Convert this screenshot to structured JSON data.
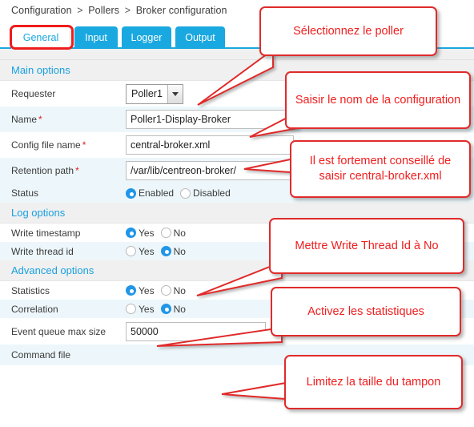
{
  "breadcrumb": {
    "items": [
      "Configuration",
      "Pollers",
      "Broker configuration"
    ],
    "separator": ">"
  },
  "tabs": [
    {
      "label": "General",
      "active": true
    },
    {
      "label": "Input",
      "active": false
    },
    {
      "label": "Logger",
      "active": false
    },
    {
      "label": "Output",
      "active": false
    }
  ],
  "sections": {
    "main": "Main options",
    "log": "Log options",
    "advanced": "Advanced options"
  },
  "fields": {
    "requester": {
      "label": "Requester",
      "value": "Poller1",
      "required": false
    },
    "name": {
      "label": "Name",
      "value": "Poller1-Display-Broker",
      "required": true,
      "required_marker": "*"
    },
    "config_file_name": {
      "label": "Config file name",
      "value": "central-broker.xml",
      "required": true,
      "required_marker": "*"
    },
    "retention_path": {
      "label": "Retention path",
      "value": "/var/lib/centreon-broker/",
      "required": true,
      "required_marker": "*"
    },
    "status": {
      "label": "Status",
      "options": [
        "Enabled",
        "Disabled"
      ],
      "selected": "Enabled"
    },
    "write_timestamp": {
      "label": "Write timestamp",
      "options": [
        "Yes",
        "No"
      ],
      "selected": "Yes"
    },
    "write_thread_id": {
      "label": "Write thread id",
      "options": [
        "Yes",
        "No"
      ],
      "selected": "No"
    },
    "statistics": {
      "label": "Statistics",
      "options": [
        "Yes",
        "No"
      ],
      "selected": "Yes"
    },
    "correlation": {
      "label": "Correlation",
      "options": [
        "Yes",
        "No"
      ],
      "selected": "No"
    },
    "event_queue_max_size": {
      "label": "Event queue max size",
      "value": "50000",
      "required": false
    },
    "command_file": {
      "label": "Command file",
      "value": "",
      "required": false
    }
  },
  "annotations": [
    {
      "id": "a1",
      "text": "Sélectionnez le poller"
    },
    {
      "id": "a2",
      "text": "Saisir le nom de la configuration"
    },
    {
      "id": "a3",
      "text": "Il est fortement conseillé de saisir central-broker.xml"
    },
    {
      "id": "a4",
      "text": "Mettre Write Thread Id à No"
    },
    {
      "id": "a5",
      "text": "Activez les statistiques"
    },
    {
      "id": "a6",
      "text": "Limitez la taille du tampon"
    }
  ],
  "colors": {
    "tab_blue": "#19a8e0",
    "section_header_text": "#1aa0e0",
    "annotation_red": "#f01e1e",
    "annotation_border": "#e02b2b",
    "radio_selected": "#2196e8",
    "required_star": "#e02020",
    "row_alt_bg": "#edf7fb"
  }
}
